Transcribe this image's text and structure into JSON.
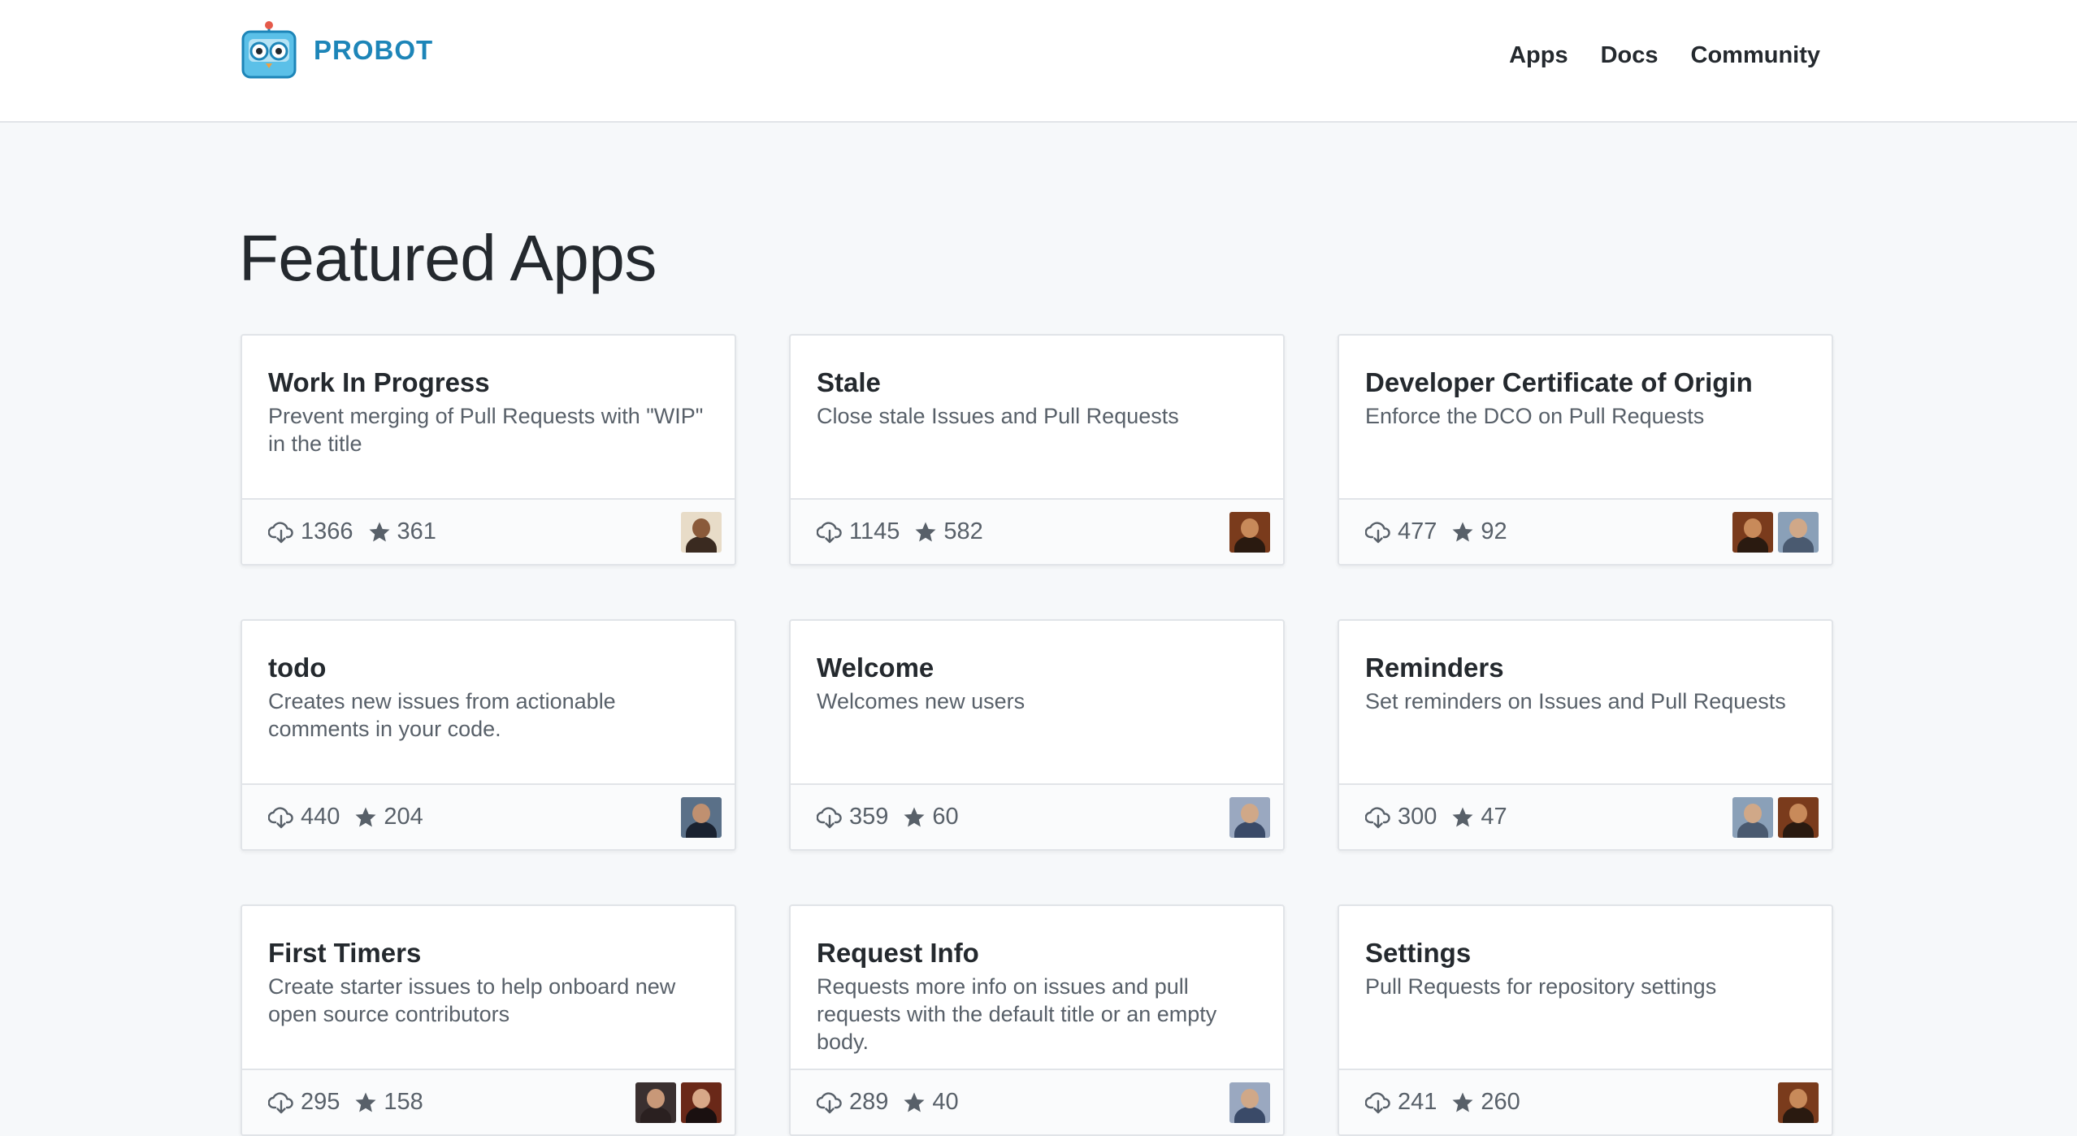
{
  "header": {
    "logo_text": "PROBOT",
    "nav": [
      {
        "label": "Apps"
      },
      {
        "label": "Docs"
      },
      {
        "label": "Community"
      }
    ]
  },
  "page": {
    "title": "Featured Apps"
  },
  "colors": {
    "brand": "#1d85b8",
    "background": "#f6f8fa",
    "card_border": "#e1e4e8",
    "muted_text": "#586069"
  },
  "icons": {
    "install": "cloud-download-icon",
    "stars": "star-icon"
  },
  "apps": [
    {
      "name": "Work In Progress",
      "description": "Prevent merging of Pull Requests with \"WIP\" in the title",
      "installs": "1366",
      "stars": "361",
      "avatars": [
        {
          "bg": "#e8dcc8",
          "head": "#8a5a3a",
          "body": "#3a2a20"
        }
      ]
    },
    {
      "name": "Stale",
      "description": "Close stale Issues and Pull Requests",
      "installs": "1145",
      "stars": "582",
      "avatars": [
        {
          "bg": "#7a3b1c",
          "head": "#c88a5a",
          "body": "#2a1a10"
        }
      ]
    },
    {
      "name": "Developer Certificate of Origin",
      "description": "Enforce the DCO on Pull Requests",
      "installs": "477",
      "stars": "92",
      "avatars": [
        {
          "bg": "#7a3b1c",
          "head": "#c88a5a",
          "body": "#2a1a10"
        },
        {
          "bg": "#8aa0b8",
          "head": "#d0a888",
          "body": "#4a5a70"
        }
      ]
    },
    {
      "name": "todo",
      "description": "Creates new issues from actionable comments in your code.",
      "installs": "440",
      "stars": "204",
      "avatars": [
        {
          "bg": "#5a7088",
          "head": "#c09070",
          "body": "#1a2230"
        }
      ]
    },
    {
      "name": "Welcome",
      "description": "Welcomes new users",
      "installs": "359",
      "stars": "60",
      "avatars": [
        {
          "bg": "#9aa8c0",
          "head": "#d0a888",
          "body": "#3a4a68"
        }
      ]
    },
    {
      "name": "Reminders",
      "description": "Set reminders on Issues and Pull Requests",
      "installs": "300",
      "stars": "47",
      "avatars": [
        {
          "bg": "#8aa0b8",
          "head": "#d0a888",
          "body": "#4a5a70"
        },
        {
          "bg": "#7a3b1c",
          "head": "#c88a5a",
          "body": "#2a1a10"
        }
      ]
    },
    {
      "name": "First Timers",
      "description": "Create starter issues to help onboard new open source contributors",
      "installs": "295",
      "stars": "158",
      "avatars": [
        {
          "bg": "#3a3030",
          "head": "#c89878",
          "body": "#2a2020"
        },
        {
          "bg": "#6a2818",
          "head": "#d8a888",
          "body": "#1a1010"
        }
      ]
    },
    {
      "name": "Request Info",
      "description": "Requests more info on issues and pull requests with the default title or an empty body.",
      "installs": "289",
      "stars": "40",
      "avatars": [
        {
          "bg": "#9aa8c0",
          "head": "#d0a888",
          "body": "#3a4a68"
        }
      ]
    },
    {
      "name": "Settings",
      "description": "Pull Requests for repository settings",
      "installs": "241",
      "stars": "260",
      "avatars": [
        {
          "bg": "#7a3b1c",
          "head": "#c88a5a",
          "body": "#2a1a10"
        }
      ]
    }
  ]
}
